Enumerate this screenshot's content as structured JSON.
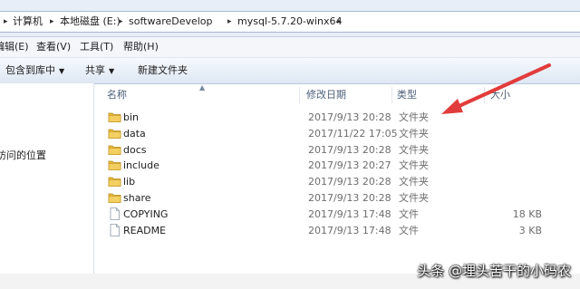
{
  "address": {
    "breadcrumbs": [
      "计算机",
      "本地磁盘 (E:)",
      "softwareDevelop",
      "mysql-5.7.20-winx64"
    ]
  },
  "menu": {
    "items": [
      "编辑(E)",
      "查看(V)",
      "工具(T)",
      "帮助(H)"
    ]
  },
  "toolbar": {
    "include_in_library": "包含到库中",
    "share": "共享",
    "new_folder": "新建文件夹"
  },
  "nav": {
    "recent_places": "访问的位置"
  },
  "columns": {
    "name": "名称",
    "modified": "修改日期",
    "type": "类型",
    "size": "大小"
  },
  "files": [
    {
      "name": "bin",
      "modified": "2017/9/13 20:28",
      "type": "文件夹",
      "size": "",
      "kind": "folder"
    },
    {
      "name": "data",
      "modified": "2017/11/22 17:05",
      "type": "文件夹",
      "size": "",
      "kind": "folder"
    },
    {
      "name": "docs",
      "modified": "2017/9/13 20:28",
      "type": "文件夹",
      "size": "",
      "kind": "folder"
    },
    {
      "name": "include",
      "modified": "2017/9/13 20:27",
      "type": "文件夹",
      "size": "",
      "kind": "folder"
    },
    {
      "name": "lib",
      "modified": "2017/9/13 20:28",
      "type": "文件夹",
      "size": "",
      "kind": "folder"
    },
    {
      "name": "share",
      "modified": "2017/9/13 20:28",
      "type": "文件夹",
      "size": "",
      "kind": "folder"
    },
    {
      "name": "COPYING",
      "modified": "2017/9/13 17:48",
      "type": "文件",
      "size": "18 KB",
      "kind": "file"
    },
    {
      "name": "README",
      "modified": "2017/9/13 17:48",
      "type": "文件",
      "size": "3 KB",
      "kind": "file"
    }
  ],
  "watermark": "头条 @埋头苦干的小码农",
  "colors": {
    "folder": "#e6b93c",
    "annotation_arrow": "#e23b3b",
    "header_text": "#4c607a"
  }
}
